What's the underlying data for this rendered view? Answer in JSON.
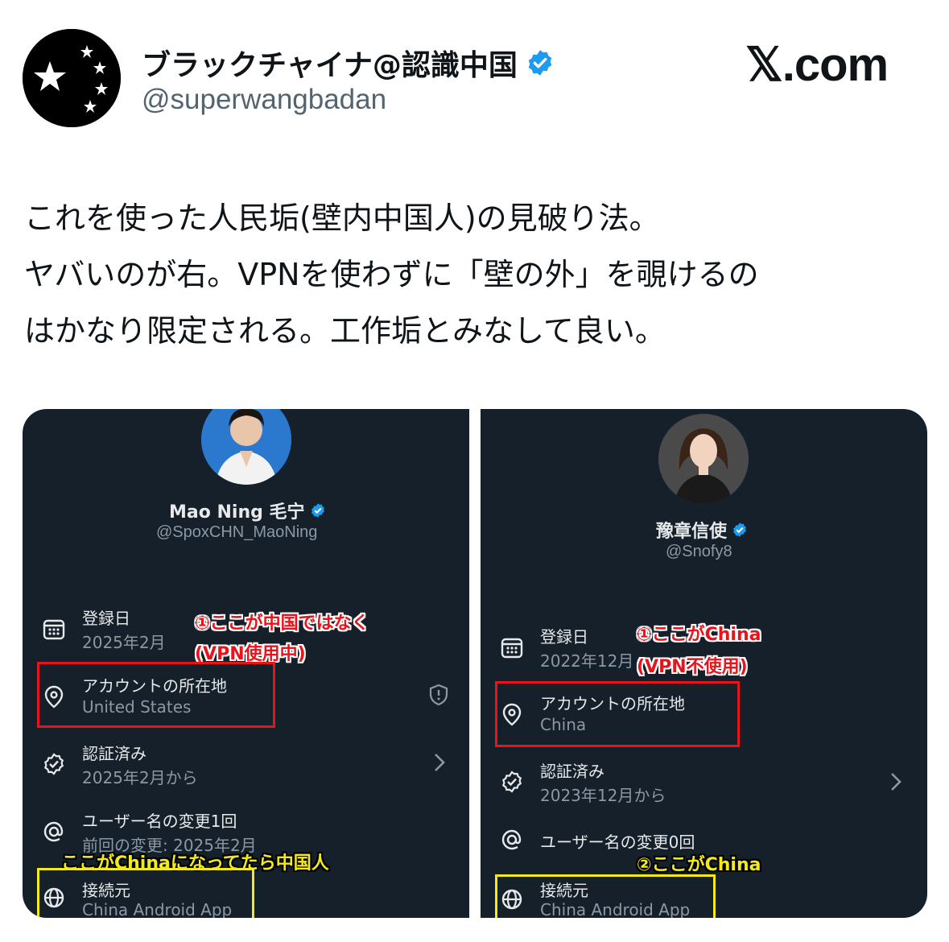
{
  "author": {
    "display_name": "ブラックチャイナ@認識中国",
    "handle": "@superwangbadan",
    "avatar_icon": "black-stars-avatar",
    "verified_icon": "verified-badge-icon"
  },
  "brand": {
    "label": "𝕏.com"
  },
  "tweet": {
    "lines": [
      "これを使った人民垢(壁内中国人)の見破り法。",
      "ヤバいのが右。VPNを使わずに「壁の外」を覗けるの",
      "はかなり限定される。工作垢とみなして良い。"
    ]
  },
  "left_panel": {
    "name": "Mao Ning 毛宁",
    "handle": "@SpoxCHN_MaoNing",
    "rows": [
      {
        "icon": "calendar-icon",
        "title": "登録日",
        "sub": "2025年2月"
      },
      {
        "icon": "location-pin-icon",
        "title": "アカウントの所在地",
        "sub": "United States"
      },
      {
        "icon": "verified-check-icon",
        "title": "認証済み",
        "sub": "2025年2月から"
      },
      {
        "icon": "at-sign-icon",
        "title": "ユーザー名の変更1回",
        "sub": "前回の変更: 2025年2月"
      },
      {
        "icon": "globe-icon",
        "title": "接続元",
        "sub": "China Android App"
      }
    ],
    "annotations": {
      "red_1": "①ここが中国ではなく",
      "red_2": "(VPN使用中)",
      "yellow": "ここがChinaになってたら中国人"
    }
  },
  "right_panel": {
    "name": "豫章信使",
    "handle": "@Snofy8",
    "rows": [
      {
        "icon": "calendar-icon",
        "title": "登録日",
        "sub": "2022年12月"
      },
      {
        "icon": "location-pin-icon",
        "title": "アカウントの所在地",
        "sub": "China"
      },
      {
        "icon": "verified-check-icon",
        "title": "認証済み",
        "sub": "2023年12月から"
      },
      {
        "icon": "at-sign-icon",
        "title": "ユーザー名の変更0回",
        "sub": ""
      },
      {
        "icon": "globe-icon",
        "title": "接続元",
        "sub": "China Android App"
      }
    ],
    "annotations": {
      "red_1": "①ここがChina",
      "red_2": "(VPN不使用)",
      "yellow": "②ここがChina"
    }
  },
  "colors": {
    "panel_bg": "#15202b",
    "verified_blue": "#1d9bf0",
    "annotation_red": "#e8141c",
    "annotation_yellow": "#f4ea1a"
  }
}
